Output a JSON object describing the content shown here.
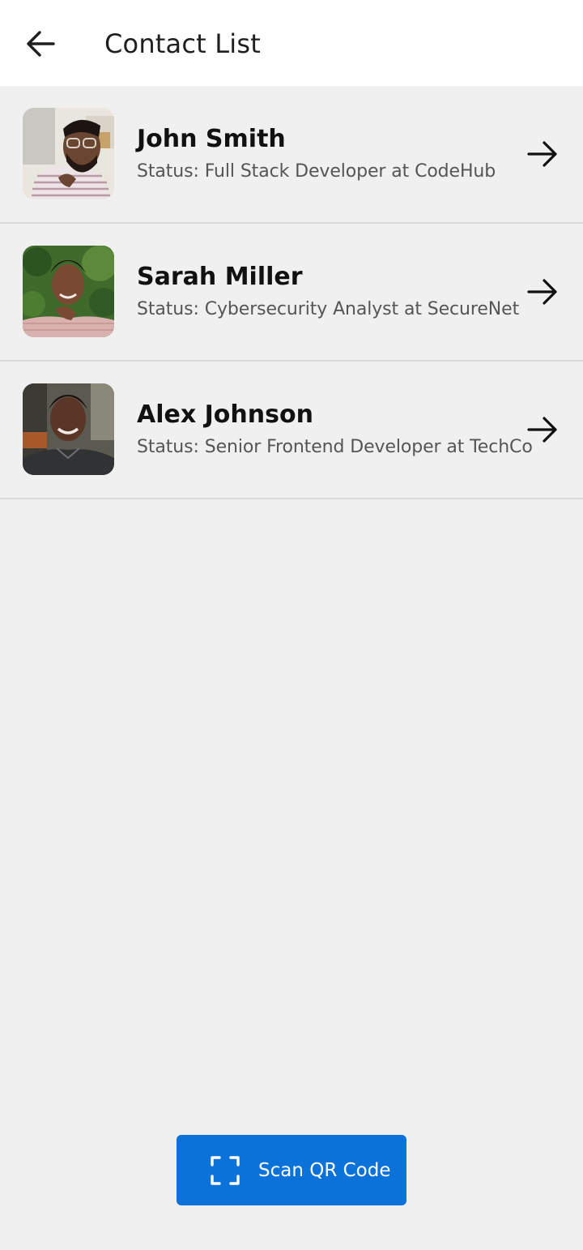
{
  "header": {
    "title": "Contact List",
    "back_icon": "arrow-left-icon"
  },
  "contacts": [
    {
      "name": "John Smith",
      "status": "Status: Full Stack Developer at CodeHub",
      "avatar": "man-with-glasses-photo",
      "action_icon": "arrow-right-icon"
    },
    {
      "name": "Sarah Miller",
      "status": "Status: Cybersecurity Analyst at SecureNet",
      "avatar": "woman-smiling-photo",
      "action_icon": "arrow-right-icon"
    },
    {
      "name": "Alex Johnson",
      "status": "Status: Senior Frontend Developer at TechCo",
      "avatar": "man-smiling-photo",
      "action_icon": "arrow-right-icon"
    }
  ],
  "scan_button": {
    "label": "Scan QR Code",
    "icon": "qr-scan-icon",
    "color": "#0a72d8"
  },
  "colors": {
    "header_bg": "#ffffff",
    "page_bg": "#f0f0f0",
    "divider": "#dadada",
    "accent": "#0a72d8"
  }
}
